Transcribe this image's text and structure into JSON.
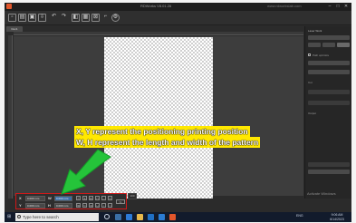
{
  "window": {
    "title": "RDWorks V8.01.26",
    "right_text": "www.rdworkslab.com",
    "doc_tab": "Doc1"
  },
  "toolbar": {
    "icons": [
      "new-file-icon",
      "open-file-icon",
      "save-icon",
      "import-icon",
      "undo-icon",
      "redo-icon",
      "zoom-window-icon",
      "select-icon",
      "group-icon",
      "array-icon",
      "settings-icon"
    ]
  },
  "panel": {
    "header": "Laser Work",
    "options": [
      "Path optimize",
      "Cut",
      "Output"
    ],
    "activate_text": "Activate Windows"
  },
  "annotations": {
    "line1": "X, Y represent the positioning printing position",
    "line2": "W, H represent the length and width of the pattern",
    "color": "#ffe800"
  },
  "propbar": {
    "x_label": "X",
    "y_label": "Y",
    "w_label": "W",
    "h_label": "H",
    "x_value": "0.000 mm",
    "y_value": "0.000 mm",
    "w_value": "0.000 mm",
    "h_value": "0.000 mm",
    "extra": "100"
  },
  "taskbar": {
    "search_placeholder": "Type here to search",
    "tray": "ENG",
    "time": "9:06 AM",
    "date": "6/14/2023"
  }
}
